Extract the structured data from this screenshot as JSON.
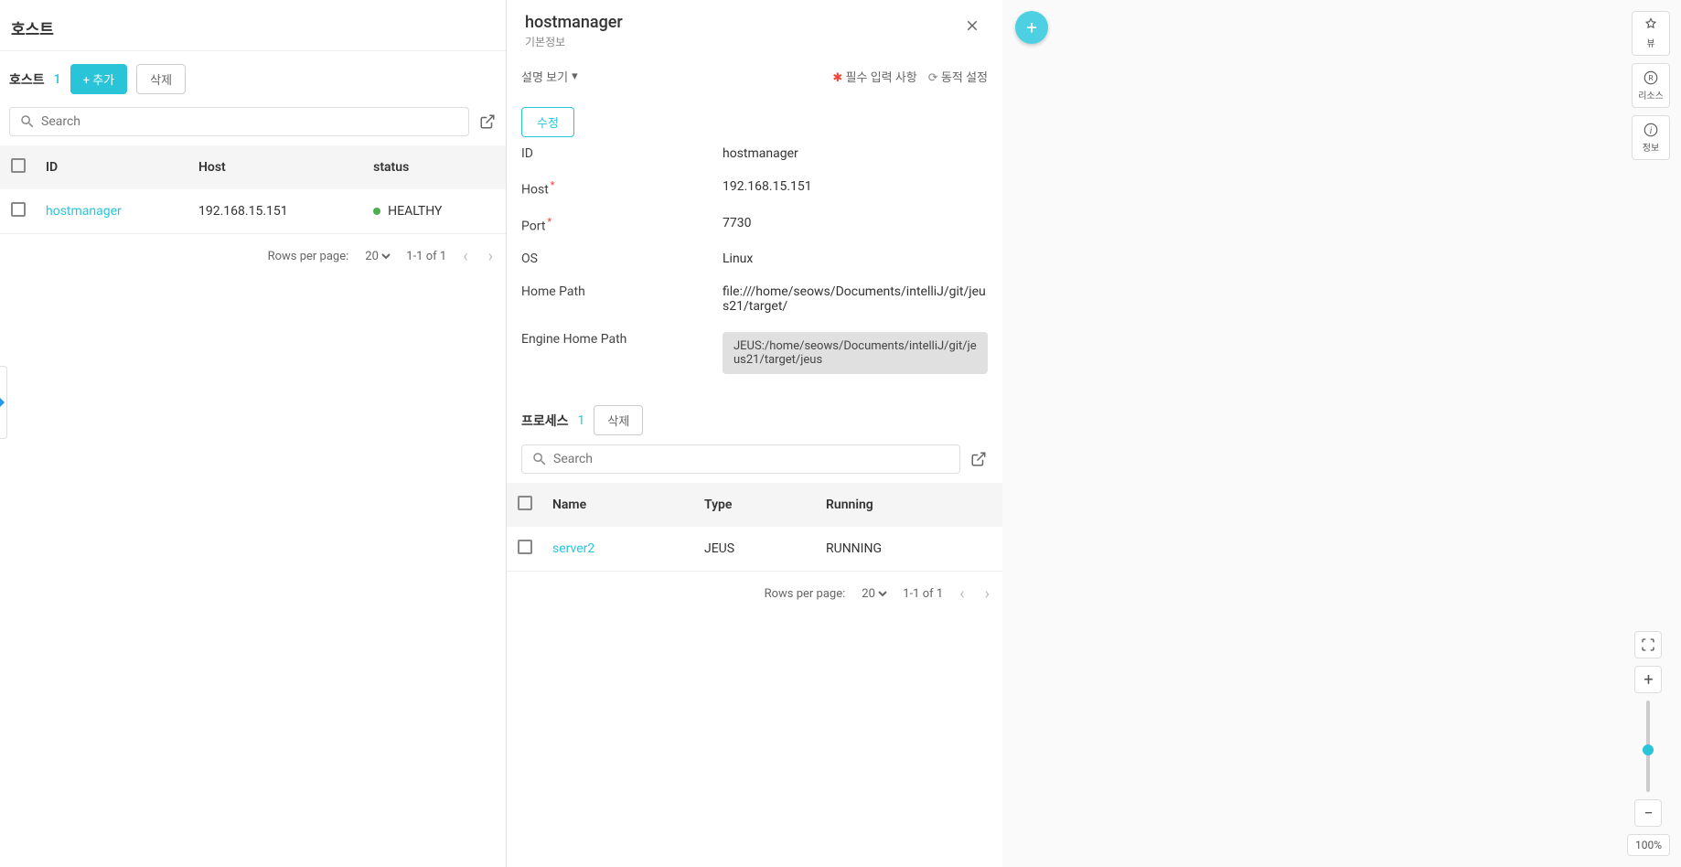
{
  "left": {
    "title": "호스트",
    "host_label": "호스트",
    "host_count": "1",
    "add_button": "추가",
    "delete_button": "삭제",
    "search_placeholder": "Search",
    "columns": {
      "id": "ID",
      "host": "Host",
      "status": "status"
    },
    "rows": [
      {
        "id": "hostmanager",
        "host": "192.168.15.151",
        "status": "HEALTHY"
      }
    ],
    "pagination": {
      "rows_per_page_label": "Rows per page:",
      "rows_per_page_value": "20",
      "range": "1-1 of 1"
    }
  },
  "detail": {
    "title": "hostmanager",
    "subtitle": "기본정보",
    "desc_toggle": "설명 보기",
    "required_label": "필수 입력 사항",
    "dynamic_label": "동적 설정",
    "edit_button": "수정",
    "fields": {
      "id_label": "ID",
      "id_value": "hostmanager",
      "host_label": "Host",
      "host_value": "192.168.15.151",
      "port_label": "Port",
      "port_value": "7730",
      "os_label": "OS",
      "os_value": "Linux",
      "homepath_label": "Home Path",
      "homepath_value": "file:///home/seows/Documents/intelliJ/git/jeus21/target/",
      "enginepath_label": "Engine Home Path",
      "enginepath_value": "JEUS:/home/seows/Documents/intelliJ/git/jeus21/target/jeus"
    },
    "process": {
      "label": "프로세스",
      "count": "1",
      "delete_button": "삭제",
      "search_placeholder": "Search",
      "columns": {
        "name": "Name",
        "type": "Type",
        "running": "Running"
      },
      "rows": [
        {
          "name": "server2",
          "type": "JEUS",
          "running": "RUNNING"
        }
      ],
      "pagination": {
        "rows_per_page_label": "Rows per page:",
        "rows_per_page_value": "20",
        "range": "1-1 of 1"
      }
    }
  },
  "canvas": {
    "tools": {
      "view": "뷰",
      "resource": "리소스",
      "info": "정보"
    },
    "zoom_label": "100%"
  }
}
